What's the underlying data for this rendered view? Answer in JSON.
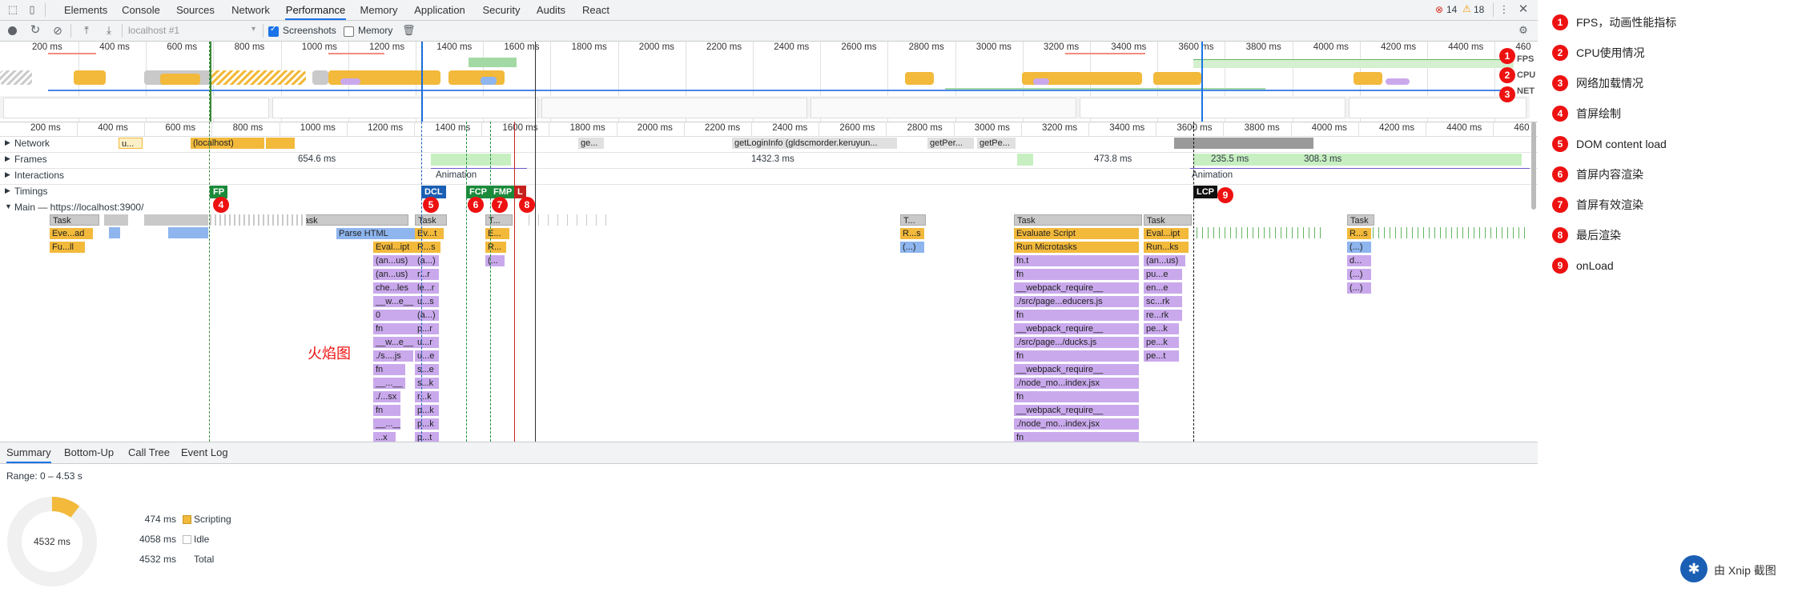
{
  "tabs": [
    "Elements",
    "Console",
    "Sources",
    "Network",
    "Performance",
    "Memory",
    "Application",
    "Security",
    "Audits",
    "React"
  ],
  "active_tab": "Performance",
  "errors": {
    "error_count": "14",
    "warning_count": "18"
  },
  "toolbar": {
    "url_placeholder": "localhost #1",
    "screenshots_label": "Screenshots",
    "memory_label": "Memory"
  },
  "overview": {
    "ruler": [
      "200 ms",
      "400 ms",
      "600 ms",
      "800 ms",
      "1000 ms",
      "1200 ms",
      "1400 ms",
      "1600 ms",
      "1800 ms",
      "2000 ms",
      "2200 ms",
      "2400 ms",
      "2600 ms",
      "2800 ms",
      "3000 ms",
      "3200 ms",
      "3400 ms",
      "3600 ms",
      "3800 ms",
      "4000 ms",
      "4200 ms",
      "4400 ms",
      "460"
    ],
    "lane_labels": [
      "FPS",
      "CPU",
      "NET"
    ]
  },
  "main_ruler": [
    "200 ms",
    "400 ms",
    "600 ms",
    "800 ms",
    "1000 ms",
    "1200 ms",
    "1400 ms",
    "1600 ms",
    "1800 ms",
    "2000 ms",
    "2200 ms",
    "2400 ms",
    "2600 ms",
    "2800 ms",
    "3000 ms",
    "3200 ms",
    "3400 ms",
    "3600 ms",
    "3800 ms",
    "4000 ms",
    "4200 ms",
    "4400 ms",
    "460"
  ],
  "tracks": {
    "network": "Network",
    "frames": "Frames",
    "interactions": "Interactions",
    "timings": "Timings",
    "main": "Main — https://localhost:3900/"
  },
  "network_items": {
    "u": "u...",
    "localhost": "(localhost)",
    "ge": "ge...",
    "login": "getLoginInfo (gldscmorder.keruyun...",
    "getper1": "getPer...",
    "getpe2": "getPe..."
  },
  "frames": {
    "f1": "654.6 ms",
    "f2": "1432.3 ms",
    "f3": "473.8 ms",
    "f4": "235.5 ms",
    "f5": "308.3 ms"
  },
  "interactions": {
    "anim1": "Animation",
    "anim2": "Animation"
  },
  "timings": {
    "fp": "FP",
    "dcl": "DCL",
    "fcp": "FCP",
    "fmp": "FMP",
    "l": "L",
    "lcp": "LCP"
  },
  "flame": {
    "c1": [
      "Task",
      "Eve...ad",
      "Fu...ll"
    ],
    "c2": [
      "Task",
      "Parse HTML",
      "Eval...ipt",
      "(an...us)",
      "(an...us)",
      "che...les",
      "__w...e__",
      "0",
      "fn",
      "__w...e__",
      "./s....js",
      "fn",
      "__...__",
      "./...sx",
      "fn",
      "__...__",
      "...x"
    ],
    "c3": [
      "Task",
      "Ev...t",
      "R...s",
      "(a...)",
      "r...r",
      "le...r",
      "u...s",
      "(a...)",
      "p...r",
      "u...r",
      "u...e",
      "s...e",
      "s...k",
      "r...k",
      "p...k",
      "p...k",
      "p...t"
    ],
    "c4": [
      "T...",
      "E...",
      "R...",
      "(..."
    ],
    "c5": [
      "T...",
      "R...s",
      "(...)"
    ],
    "c6": [
      "Task",
      "Evaluate Script",
      "Run Microtasks",
      "fn.t",
      "fn",
      "__webpack_require__",
      "./src/page...educers.js",
      "fn",
      "__webpack_require__",
      "./src/page.../ducks.js",
      "fn",
      "__webpack_require__",
      "./node_mo...index.jsx",
      "fn",
      "__webpack_require__",
      "./node_mo...index.jsx",
      "fn"
    ],
    "c7": [
      "Task",
      "Eval...ipt",
      "Run...ks",
      "(an...us)",
      "pu...e",
      "en...e",
      "sc...rk",
      "re...rk",
      "pe...k",
      "pe...k",
      "pe...t"
    ],
    "c8": [
      "Task",
      "R...s",
      "(...)",
      "d...",
      "(...)",
      "(...)"
    ]
  },
  "flame_label": "火焰图",
  "bottom_tabs": [
    "Summary",
    "Bottom-Up",
    "Call Tree",
    "Event Log"
  ],
  "summary": {
    "range": "Range: 0 – 4.53 s",
    "donut_center": "4532 ms",
    "rows": [
      {
        "value": "474 ms",
        "label": "Scripting",
        "color": "#f2b93b"
      },
      {
        "value": "4058 ms",
        "label": "Idle",
        "color": "#ffffff"
      },
      {
        "value": "4532 ms",
        "label": "Total",
        "color": ""
      }
    ],
    "scripting_fraction": 0.1046
  },
  "legend": [
    {
      "num": "1",
      "text": "FPS，动画性能指标"
    },
    {
      "num": "2",
      "text": "CPU使用情况"
    },
    {
      "num": "3",
      "text": "网络加载情况"
    },
    {
      "num": "4",
      "text": "首屏绘制"
    },
    {
      "num": "5",
      "text": "DOM content load"
    },
    {
      "num": "6",
      "text": "首屏内容渲染"
    },
    {
      "num": "7",
      "text": "首屏有效渲染"
    },
    {
      "num": "8",
      "text": "最后渲染"
    },
    {
      "num": "9",
      "text": "onLoad"
    }
  ],
  "watermark": "由 Xnip 截图"
}
